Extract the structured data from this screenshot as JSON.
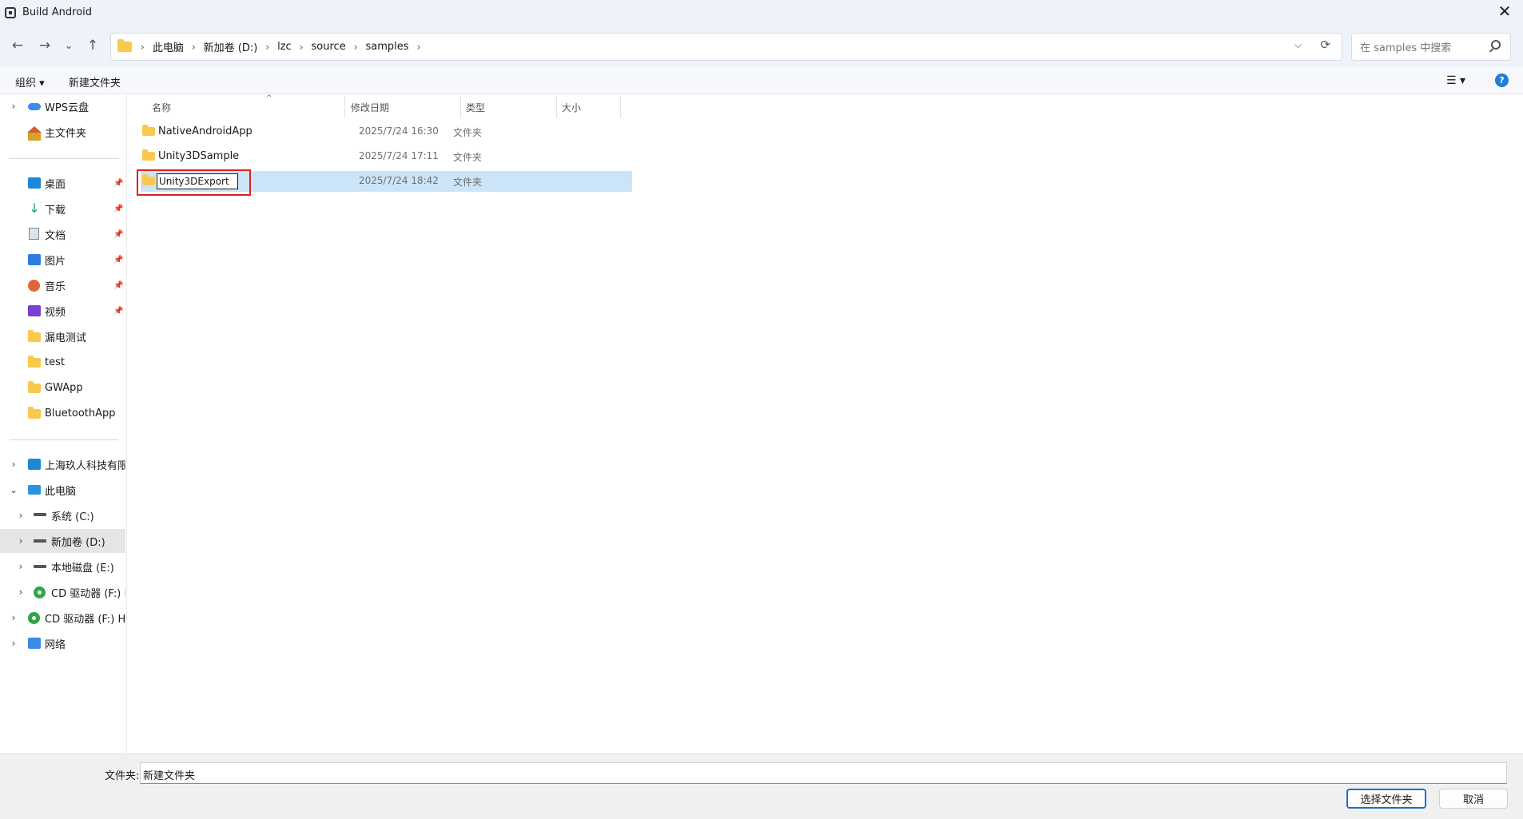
{
  "window": {
    "title": "Build Android",
    "close_label": "✕"
  },
  "nav": {
    "back": "←",
    "forward": "→",
    "recent": "⌄",
    "up": "↑",
    "breadcrumbs": [
      "此电脑",
      "新加卷 (D:)",
      "lzc",
      "source",
      "samples"
    ],
    "separator": "›",
    "dropdown": "⌵",
    "refresh": "⟳",
    "search_placeholder": "在 samples 中搜索"
  },
  "toolbar": {
    "organize": "组织 ▾",
    "new_folder": "新建文件夹",
    "view": "☰ ▾",
    "help": "?"
  },
  "sidebar": {
    "quick": [
      {
        "label": "WPS云盘",
        "icon": "cloud-icon",
        "expand": "›"
      },
      {
        "label": "主文件夹",
        "icon": "home-icon"
      }
    ],
    "pinned": [
      {
        "label": "桌面",
        "icon": "desktop-icon"
      },
      {
        "label": "下载",
        "icon": "download-icon"
      },
      {
        "label": "文档",
        "icon": "documents-icon"
      },
      {
        "label": "图片",
        "icon": "pictures-icon"
      },
      {
        "label": "音乐",
        "icon": "music-icon"
      },
      {
        "label": "视频",
        "icon": "videos-icon"
      }
    ],
    "folders": [
      "漏电测试",
      "test",
      "GWApp",
      "BluetoothApp"
    ],
    "tree": [
      {
        "label": "上海玖人科技有限公",
        "icon": "org-icon",
        "expand": "›"
      },
      {
        "label": "此电脑",
        "icon": "pc-icon",
        "expand": "⌄"
      },
      {
        "label": "系统 (C:)",
        "icon": "system-drive-icon",
        "expand": "›"
      },
      {
        "label": "新加卷 (D:)",
        "icon": "drive-icon",
        "expand": "›"
      },
      {
        "label": "本地磁盘 (E:)",
        "icon": "drive-icon",
        "expand": "›"
      },
      {
        "label": "CD 驱动器 (F:) Hi",
        "icon": "cd-icon",
        "expand": "›"
      },
      {
        "label": "CD 驱动器 (F:) HiS",
        "icon": "cd-icon",
        "expand": "›"
      },
      {
        "label": "网络",
        "icon": "network-icon",
        "expand": "›"
      }
    ],
    "pin_glyph": "📌"
  },
  "columns": {
    "name": "名称",
    "modified": "修改日期",
    "type": "类型",
    "size": "大小",
    "sort_glyph": "^"
  },
  "files": [
    {
      "name": "NativeAndroidApp",
      "modified": "2025/7/24 16:30",
      "type": "文件夹"
    },
    {
      "name": "Unity3DSample",
      "modified": "2025/7/24 17:11",
      "type": "文件夹"
    },
    {
      "name": "Unity3DExport",
      "modified": "2025/7/24 18:42",
      "type": "文件夹",
      "renaming": true
    }
  ],
  "footer": {
    "folder_label": "文件夹:",
    "folder_value": "新建文件夹",
    "select_button": "选择文件夹",
    "cancel_button": "取消"
  },
  "colors": {
    "accent": "#1d6fce",
    "selection": "#cce4f7",
    "highlight_box": "#e02020",
    "folder": "#f9c94e"
  }
}
